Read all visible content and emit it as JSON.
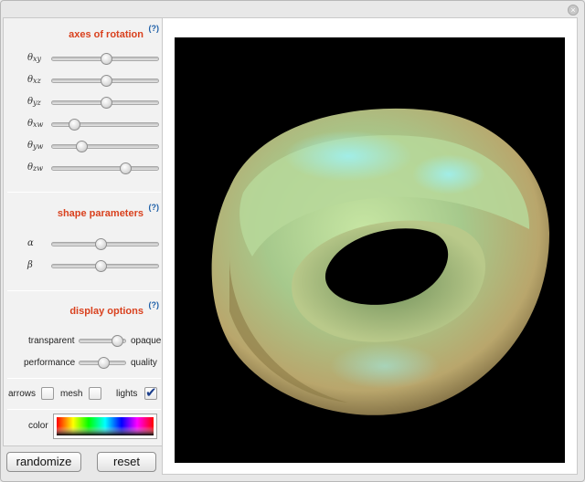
{
  "window": {
    "close_glyph": "×"
  },
  "sections": {
    "rotation": {
      "title": "axes of rotation",
      "help": "(?)"
    },
    "shape": {
      "title": "shape parameters",
      "help": "(?)"
    },
    "display": {
      "title": "display options",
      "help": "(?)"
    }
  },
  "rotation_sliders": [
    {
      "symbol": "θ",
      "sub": "xy",
      "value": 0.5
    },
    {
      "symbol": "θ",
      "sub": "xz",
      "value": 0.5
    },
    {
      "symbol": "θ",
      "sub": "yz",
      "value": 0.5
    },
    {
      "symbol": "θ",
      "sub": "xw",
      "value": 0.2
    },
    {
      "symbol": "θ",
      "sub": "yw",
      "value": 0.27
    },
    {
      "symbol": "θ",
      "sub": "zw",
      "value": 0.68
    }
  ],
  "shape_sliders": [
    {
      "symbol": "α",
      "value": 0.45
    },
    {
      "symbol": "β",
      "value": 0.45
    }
  ],
  "opacity": {
    "left_label": "transparent",
    "right_label": "opaque",
    "value": 0.78
  },
  "quality": {
    "left_label": "performance",
    "right_label": "quality",
    "value": 0.5
  },
  "checkboxes": [
    {
      "label": "arrows",
      "checked": false
    },
    {
      "label": "mesh",
      "checked": false
    },
    {
      "label": "lights",
      "checked": true
    }
  ],
  "color": {
    "label": "color"
  },
  "buttons": {
    "randomize": "randomize",
    "reset": "reset"
  },
  "colors": {
    "accent": "#d9411e",
    "help": "#1d5fa8",
    "canvas_bg": "#000000"
  }
}
